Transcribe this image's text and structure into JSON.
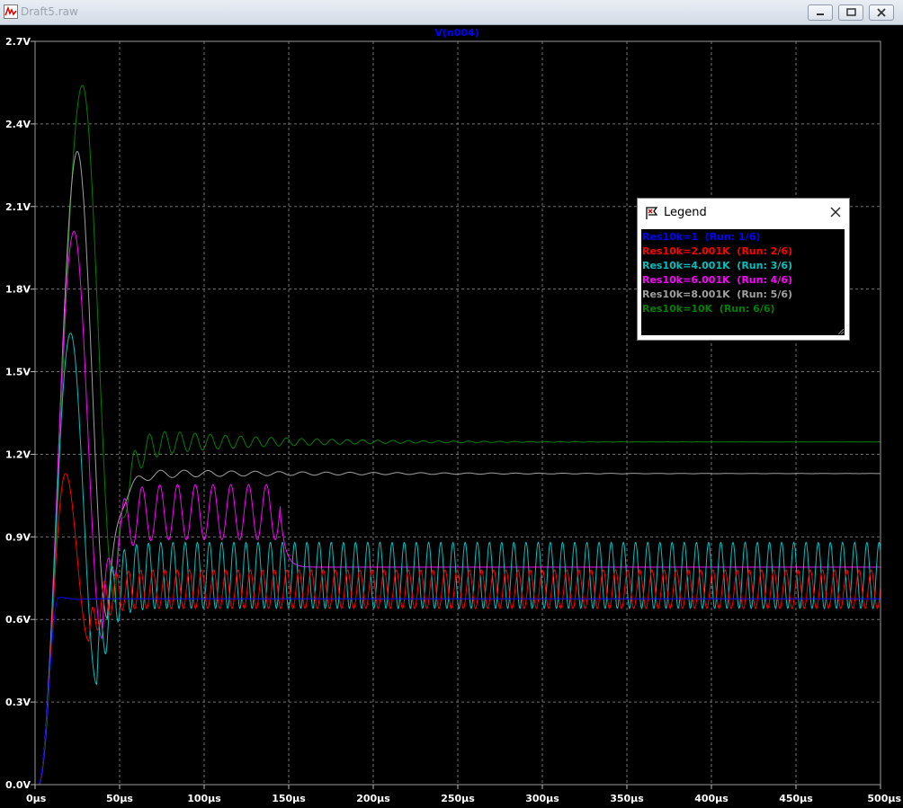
{
  "window": {
    "title": "Draft5.raw"
  },
  "legend": {
    "title": "Legend",
    "entries": [
      {
        "label": "Res10k=1  (Run: 1/6)",
        "color": "#0000ff"
      },
      {
        "label": "Res10k=2.001K  (Run: 2/6)",
        "color": "#ff0000"
      },
      {
        "label": "Res10k=4.001K  (Run: 3/6)",
        "color": "#00c0c0"
      },
      {
        "label": "Res10k=6.001K  (Run: 4/6)",
        "color": "#ff00ff"
      },
      {
        "label": "Res10k=8.001K  (Run: 5/6)",
        "color": "#a0a0a0"
      },
      {
        "label": "Res10k=10K  (Run: 6/6)",
        "color": "#008000"
      }
    ]
  },
  "chart_data": {
    "type": "line",
    "title": "V(n004)",
    "xlabel": "",
    "ylabel": "",
    "xlim": [
      0,
      500
    ],
    "ylim": [
      0,
      2.7
    ],
    "x_unit": "µs",
    "grid": true,
    "x_ticks": [
      "0µs",
      "50µs",
      "100µs",
      "150µs",
      "200µs",
      "250µs",
      "300µs",
      "350µs",
      "400µs",
      "450µs",
      "500µs"
    ],
    "y_ticks": [
      "0.0V",
      "0.3V",
      "0.6V",
      "0.9V",
      "1.2V",
      "1.5V",
      "1.8V",
      "2.1V",
      "2.4V",
      "2.7V"
    ],
    "series": [
      {
        "name": "Res10k=1  (Run: 1/6)",
        "color": "#0000ff",
        "model": {
          "peak": 0.68,
          "peak_t": 14,
          "rise_start": 2,
          "settle": 0.675,
          "osc_amp": 0,
          "osc_period": 8,
          "osc_decay": 0,
          "osc_until": 500,
          "tail": 0.675
        }
      },
      {
        "name": "Res10k=2.001K  (Run: 2/6)",
        "color": "#ff0000",
        "model": {
          "peak": 1.13,
          "peak_t": 18,
          "rise_start": 2,
          "settle": 0.71,
          "osc_amp": 0.07,
          "osc_period": 7.2,
          "osc_decay": 0,
          "osc_until": 500,
          "tail": 0.71
        }
      },
      {
        "name": "Res10k=4.001K  (Run: 3/6)",
        "color": "#00c0c0",
        "model": {
          "peak": 1.64,
          "peak_t": 21,
          "rise_start": 2,
          "settle": 0.76,
          "osc_amp": 0.12,
          "osc_period": 7.2,
          "osc_decay": 0,
          "osc_until": 500,
          "tail": 0.76
        }
      },
      {
        "name": "Res10k=6.001K  (Run: 4/6)",
        "color": "#ff00ff",
        "model": {
          "peak": 2.01,
          "peak_t": 23,
          "rise_start": 2,
          "settle": 0.99,
          "osc_amp": 0.1,
          "osc_period": 10.5,
          "osc_decay": 0,
          "osc_until": 145,
          "tail": 0.79
        }
      },
      {
        "name": "Res10k=8.001K  (Run: 5/6)",
        "color": "#a0a0a0",
        "model": {
          "peak": 2.3,
          "peak_t": 25,
          "rise_start": 2,
          "settle": 1.13,
          "osc_amp": 0.02,
          "osc_period": 14,
          "osc_decay": 0.01,
          "osc_until": 500,
          "tail": 1.13
        }
      },
      {
        "name": "Res10k=10K  (Run: 6/6)",
        "color": "#008000",
        "model": {
          "peak": 2.54,
          "peak_t": 28,
          "rise_start": 2,
          "settle": 1.245,
          "osc_amp": 0.065,
          "osc_period": 9,
          "osc_decay": 0.015,
          "osc_until": 500,
          "tail": 1.245
        }
      }
    ]
  }
}
